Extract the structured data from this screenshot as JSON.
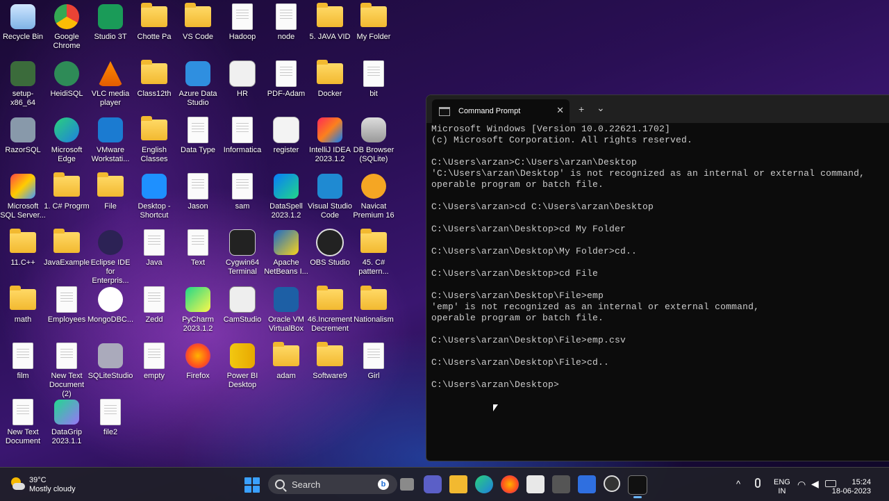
{
  "desktop": {
    "icons": [
      {
        "label": "Recycle Bin",
        "icon": "recycle-bin-icon"
      },
      {
        "label": "Google Chrome",
        "icon": "chrome-icon"
      },
      {
        "label": "Studio 3T",
        "icon": "studio3t-icon"
      },
      {
        "label": "Chotte Pa",
        "icon": "folder-icon"
      },
      {
        "label": "VS Code",
        "icon": "folder-icon"
      },
      {
        "label": "Hadoop",
        "icon": "file-icon"
      },
      {
        "label": "node",
        "icon": "file-icon"
      },
      {
        "label": "5. JAVA VID",
        "icon": "folder-icon"
      },
      {
        "label": "My Folder",
        "icon": "folder-icon"
      },
      {
        "label": "setup-x86_64",
        "icon": "installer-icon"
      },
      {
        "label": "HeidiSQL",
        "icon": "heidisql-icon"
      },
      {
        "label": "VLC media player",
        "icon": "vlc-icon"
      },
      {
        "label": "Class12th",
        "icon": "folder-icon"
      },
      {
        "label": "Azure Data Studio",
        "icon": "azure-data-studio-icon"
      },
      {
        "label": "HR",
        "icon": "document-icon"
      },
      {
        "label": "PDF-Adam",
        "icon": "file-icon"
      },
      {
        "label": "Docker",
        "icon": "folder-icon"
      },
      {
        "label": "bit",
        "icon": "file-icon"
      },
      {
        "label": "RazorSQL",
        "icon": "razorsql-icon"
      },
      {
        "label": "Microsoft Edge",
        "icon": "edge-icon"
      },
      {
        "label": "VMware Workstati...",
        "icon": "vmware-icon"
      },
      {
        "label": "English Classes",
        "icon": "folder-icon"
      },
      {
        "label": "Data Type",
        "icon": "file-icon"
      },
      {
        "label": "Informatica",
        "icon": "file-icon"
      },
      {
        "label": "register",
        "icon": "image-file-icon"
      },
      {
        "label": "IntelliJ IDEA 2023.1.2",
        "icon": "intellij-icon"
      },
      {
        "label": "DB Browser (SQLite)",
        "icon": "db-browser-icon"
      },
      {
        "label": "Microsoft SQL Server...",
        "icon": "sql-server-icon"
      },
      {
        "label": "1. C# Progrm",
        "icon": "folder-icon"
      },
      {
        "label": "File",
        "icon": "folder-icon"
      },
      {
        "label": "Desktop - Shortcut",
        "icon": "folder-shortcut-icon"
      },
      {
        "label": "Jason",
        "icon": "file-icon"
      },
      {
        "label": "sam",
        "icon": "file-icon"
      },
      {
        "label": "DataSpell 2023.1.2",
        "icon": "dataspell-icon"
      },
      {
        "label": "Visual Studio Code",
        "icon": "vscode-icon"
      },
      {
        "label": "Navicat Premium 16",
        "icon": "navicat-icon"
      },
      {
        "label": "11.C++",
        "icon": "folder-icon"
      },
      {
        "label": "JavaExample",
        "icon": "folder-icon"
      },
      {
        "label": "Eclipse IDE for Enterpris...",
        "icon": "eclipse-icon"
      },
      {
        "label": "Java",
        "icon": "file-icon"
      },
      {
        "label": "Text",
        "icon": "file-icon"
      },
      {
        "label": "Cygwin64 Terminal",
        "icon": "cygwin-icon"
      },
      {
        "label": "Apache NetBeans I...",
        "icon": "netbeans-icon"
      },
      {
        "label": "OBS Studio",
        "icon": "obs-icon"
      },
      {
        "label": "45. C# pattern...",
        "icon": "folder-icon"
      },
      {
        "label": "math",
        "icon": "folder-icon"
      },
      {
        "label": "Employees",
        "icon": "file-icon"
      },
      {
        "label": "MongoDBC...",
        "icon": "mongodb-icon"
      },
      {
        "label": "Zedd",
        "icon": "file-icon"
      },
      {
        "label": "PyCharm 2023.1.2",
        "icon": "pycharm-icon"
      },
      {
        "label": "CamStudio",
        "icon": "camstudio-icon"
      },
      {
        "label": "Oracle VM VirtualBox",
        "icon": "virtualbox-icon"
      },
      {
        "label": "46.Increment Decrement",
        "icon": "folder-icon"
      },
      {
        "label": "Nationalism",
        "icon": "folder-icon"
      },
      {
        "label": "film",
        "icon": "file-icon"
      },
      {
        "label": "New Text Document (2)",
        "icon": "file-icon"
      },
      {
        "label": "SQLiteStudio",
        "icon": "sqlitestudio-icon"
      },
      {
        "label": "empty",
        "icon": "file-icon"
      },
      {
        "label": "Firefox",
        "icon": "firefox-icon"
      },
      {
        "label": "Power BI Desktop",
        "icon": "powerbi-icon"
      },
      {
        "label": "adam",
        "icon": "folder-icon"
      },
      {
        "label": "Software9",
        "icon": "folder-icon"
      },
      {
        "label": "Girl",
        "icon": "file-icon"
      },
      {
        "label": "New Text Document",
        "icon": "file-icon"
      },
      {
        "label": "DataGrip 2023.1.1",
        "icon": "datagrip-icon"
      },
      {
        "label": "file2",
        "icon": "file-icon"
      }
    ]
  },
  "terminal": {
    "tab_title": "Command Prompt",
    "close_glyph": "✕",
    "new_tab_glyph": "+",
    "dropdown_glyph": "⌄",
    "lines": [
      "Microsoft Windows [Version 10.0.22621.1702]",
      "(c) Microsoft Corporation. All rights reserved.",
      "",
      "C:\\Users\\arzan>C:\\Users\\arzan\\Desktop",
      "'C:\\Users\\arzan\\Desktop' is not recognized as an internal or external command,",
      "operable program or batch file.",
      "",
      "C:\\Users\\arzan>cd C:\\Users\\arzan\\Desktop",
      "",
      "C:\\Users\\arzan\\Desktop>cd My Folder",
      "",
      "C:\\Users\\arzan\\Desktop\\My Folder>cd..",
      "",
      "C:\\Users\\arzan\\Desktop>cd File",
      "",
      "C:\\Users\\arzan\\Desktop\\File>emp",
      "'emp' is not recognized as an internal or external command,",
      "operable program or batch file.",
      "",
      "C:\\Users\\arzan\\Desktop\\File>emp.csv",
      "",
      "C:\\Users\\arzan\\Desktop\\File>cd..",
      "",
      "C:\\Users\\arzan\\Desktop>"
    ]
  },
  "taskbar": {
    "weather_temp": "39°C",
    "weather_desc": "Mostly cloudy",
    "search_placeholder": "Search",
    "bing_glyph": "b",
    "tray_chevron": "^",
    "language_top": "ENG",
    "language_bottom": "IN",
    "time": "15:24",
    "date": "18-06-2023"
  },
  "colors": {
    "console_bg": "#0c0c0c",
    "console_text": "#cccccc",
    "taskbar_bg": "#202028",
    "accent": "#3aa0ff"
  }
}
